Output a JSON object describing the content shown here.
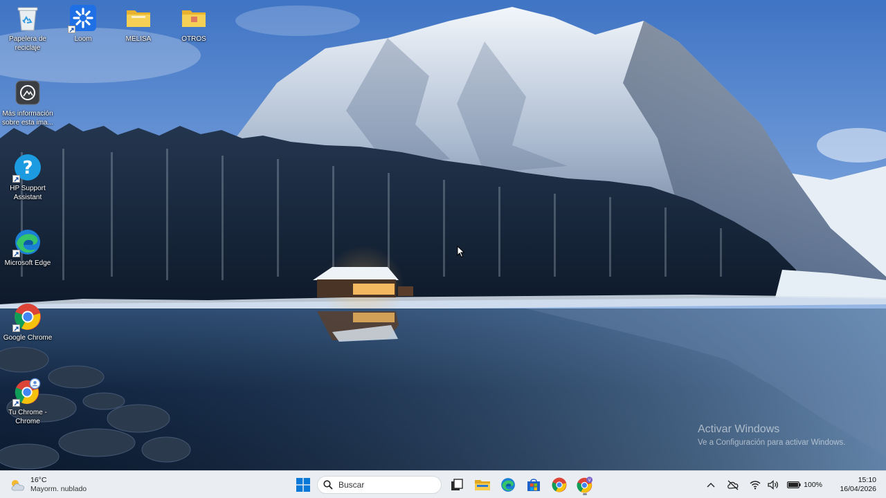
{
  "desktop": {
    "icons": [
      {
        "label": "Papelera de reciclaje",
        "icon": "recycle-bin-icon"
      },
      {
        "label": "Loom",
        "icon": "loom-icon"
      },
      {
        "label": "MELISA",
        "icon": "folder-icon"
      },
      {
        "label": "OTROS",
        "icon": "folder-icon"
      },
      {
        "label": "Más información sobre esta ima...",
        "icon": "camera-info-icon"
      },
      {
        "label": "HP Support Assistant",
        "icon": "help-icon"
      },
      {
        "label": "Microsoft Edge",
        "icon": "edge-icon"
      },
      {
        "label": "Google Chrome",
        "icon": "chrome-icon"
      },
      {
        "label": "Tu Chrome - Chrome",
        "icon": "chrome-profile-icon"
      }
    ]
  },
  "watermark": {
    "title": "Activar Windows",
    "subtitle": "Ve a Configuración para activar Windows."
  },
  "taskbar": {
    "weather": {
      "temp": "16°C",
      "condition": "Mayorm. nublado"
    },
    "search": {
      "placeholder": "Buscar"
    },
    "apps": [
      "start-icon",
      "task-view-icon",
      "file-explorer-icon",
      "edge-icon",
      "store-icon",
      "chrome-icon",
      "chrome-profile-icon"
    ],
    "tray": {
      "battery": "100%",
      "time": "15:10",
      "date": "16/04/2026"
    }
  },
  "colors": {
    "taskbar_bg": "#eaedf1",
    "folder_yellow": "#f4c842",
    "windows_blue": "#0078d4"
  }
}
